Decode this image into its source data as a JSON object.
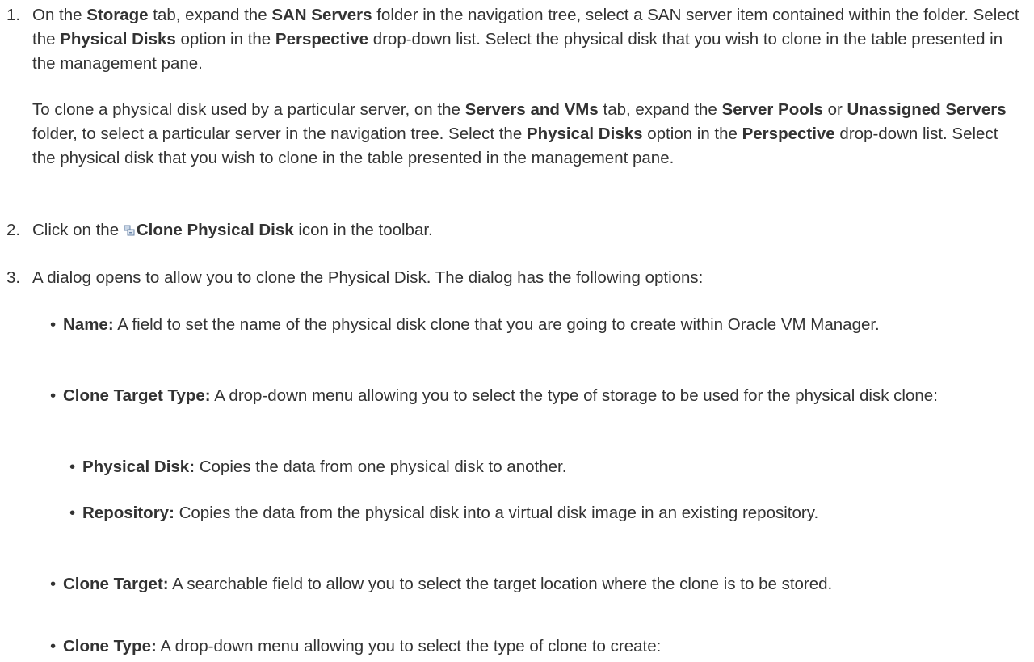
{
  "steps": [
    {
      "number": "1.",
      "p1": [
        "On the ",
        "Storage",
        " tab, expand the ",
        "SAN Servers",
        " folder in the navigation tree, select a SAN server item contained within the folder. Select the ",
        "Physical Disks",
        " option in the ",
        "Perspective",
        " drop-down list. Select the physical disk that you wish to clone in the table presented in the management pane."
      ],
      "p2": [
        "To clone a physical disk used by a particular server, on the ",
        "Servers and VMs",
        " tab, expand the ",
        "Server Pools",
        " or ",
        "Unassigned Servers",
        " folder, to select a particular server in the navigation tree. Select the ",
        "Physical Disks",
        " option in the ",
        "Perspective",
        " drop-down list. Select the physical disk that you wish to clone in the table presented in the management pane."
      ]
    },
    {
      "number": "2.",
      "pre": "Click on the ",
      "icon": "clone-physical-disk-icon",
      "bold": "Clone Physical Disk",
      "post": " icon in the toolbar."
    },
    {
      "number": "3.",
      "text": "A dialog opens to allow you to clone the Physical Disk. The dialog has the following options:"
    }
  ],
  "options": [
    {
      "term": "Name:",
      "desc": " A field to set the name of the physical disk clone that you are going to create within Oracle VM Manager."
    },
    {
      "term": "Clone Target Type:",
      "desc": " A drop-down menu allowing you to select the type of storage to be used for the physical disk clone:",
      "sub": [
        {
          "term": "Physical Disk:",
          "desc": " Copies the data from one physical disk to another."
        },
        {
          "term": "Repository:",
          "desc": " Copies the data from the physical disk into a virtual disk image in an existing repository."
        }
      ]
    },
    {
      "term": "Clone Target:",
      "desc": " A searchable field to allow you to select the target location where the clone is to be stored."
    },
    {
      "term": "Clone Type:",
      "desc": " A drop-down menu allowing you to select the type of clone to create:"
    }
  ],
  "bullet_glyph": "•",
  "colors": {
    "text": "#333333",
    "background": "#ffffff",
    "icon": "#6b86a8"
  }
}
